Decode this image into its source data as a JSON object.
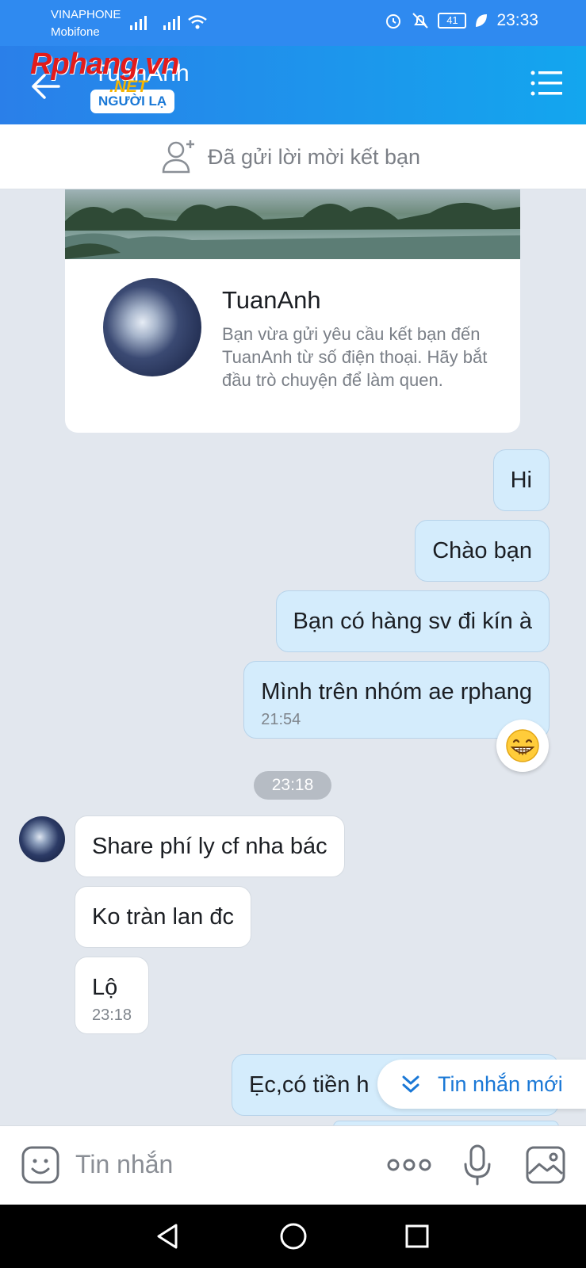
{
  "status_bar": {
    "carrier_1": "VINAPHONE",
    "carrier_2": "Mobifone",
    "battery": "41",
    "time": "23:33"
  },
  "header": {
    "contact_name": "TuanAnh",
    "badge": "NGƯỜI LẠ",
    "watermark_logo": "Rphang.vn",
    "watermark_suffix": ".NET"
  },
  "friend_request": {
    "status_text": "Đã gửi lời mời kết bạn"
  },
  "profile_card": {
    "name": "TuanAnh",
    "description": "Bạn vừa gửi yêu cầu kết bạn đến TuanAnh từ số điện thoại. Hãy bắt đầu trò chuyện để làm quen."
  },
  "messages": [
    {
      "text": "Hi"
    },
    {
      "text": "Chào bạn"
    },
    {
      "text": "Bạn có hàng sv đi kín à"
    },
    {
      "text": "Mình trên nhóm ae rphang",
      "time": "21:54"
    },
    {
      "separator": "23:18"
    },
    {
      "text": "Share phí ly cf nha bác"
    },
    {
      "text": "Ko tràn lan đc"
    },
    {
      "text": "Lộ",
      "time": "23:18"
    },
    {
      "text": "Ẹc,có tiền h"
    }
  ],
  "new_message_pill": {
    "label": "Tin nhắn mới"
  },
  "input": {
    "placeholder": "Tin nhắn"
  },
  "colors": {
    "header_blue": "#2a7fe9",
    "outgoing_bubble": "#d4ecfc",
    "incoming_bubble": "#ffffff",
    "accent_text": "#1a78d6"
  },
  "icons": [
    "back-arrow-icon",
    "menu-icon",
    "add-friend-icon",
    "emoji-icon",
    "more-icon",
    "microphone-icon",
    "image-icon",
    "grinning-emoji-icon",
    "double-chevron-down-icon",
    "nav-back-icon",
    "nav-home-icon",
    "nav-recents-icon"
  ]
}
